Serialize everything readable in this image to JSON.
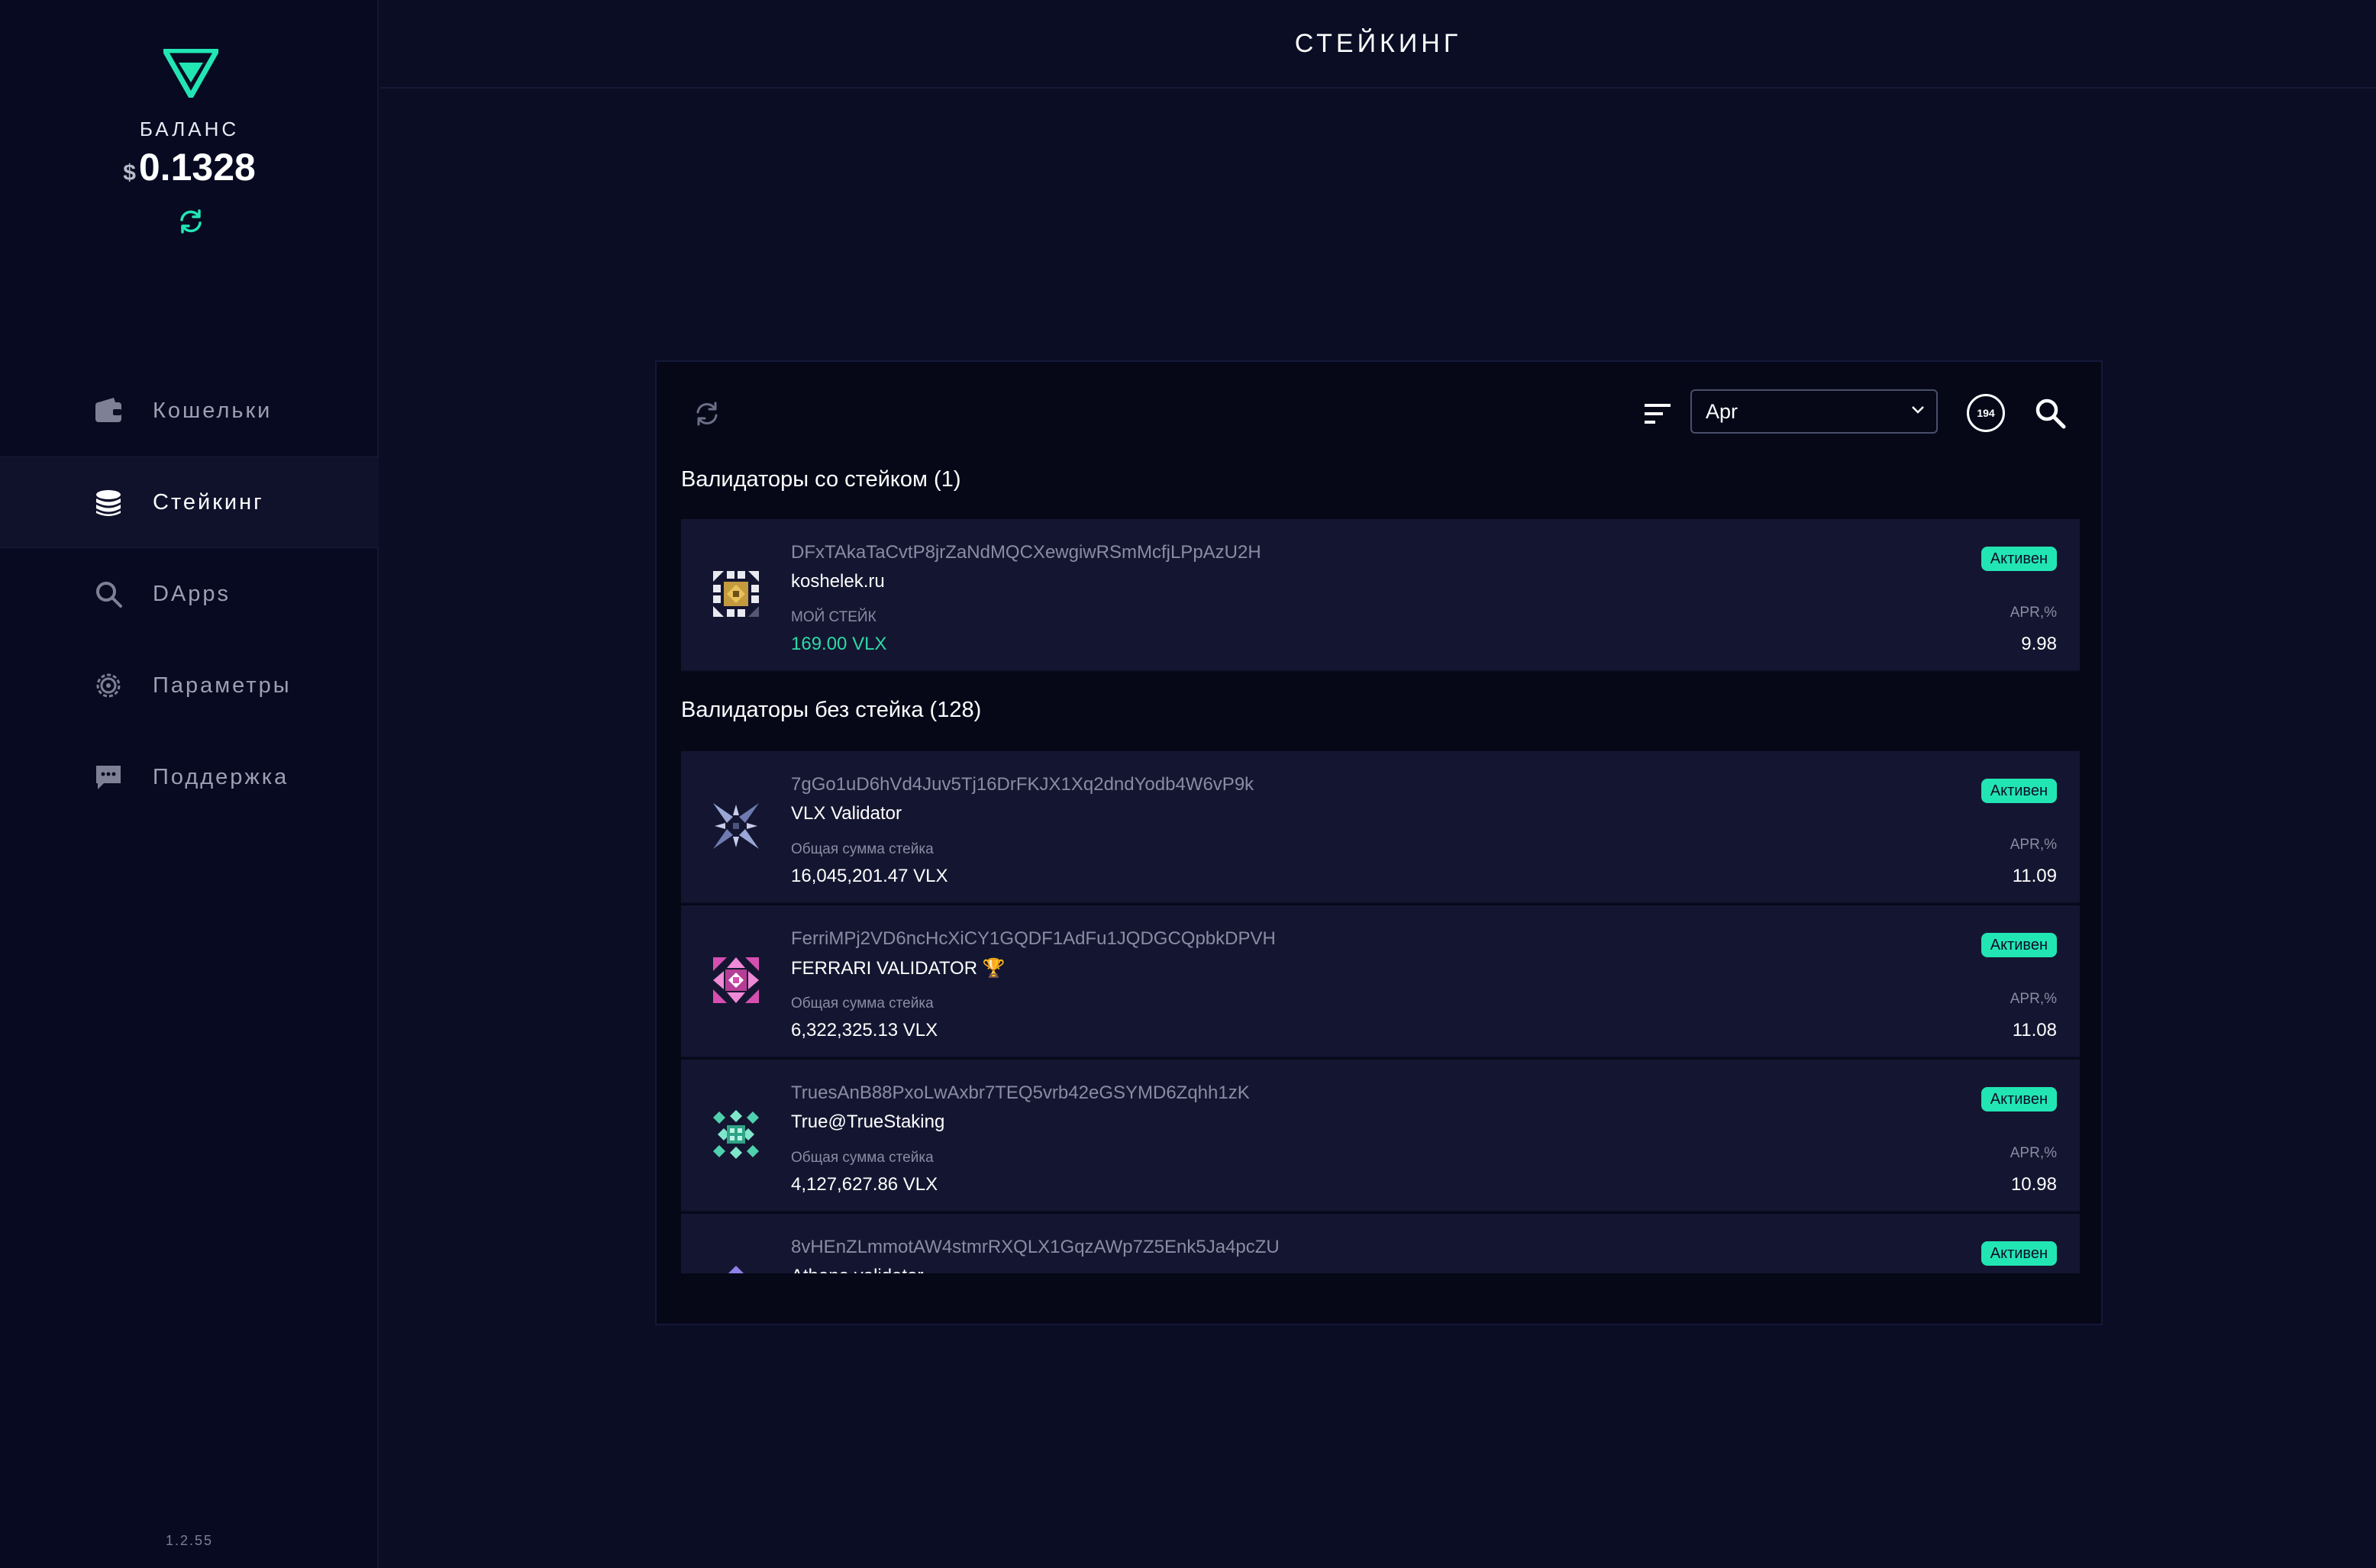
{
  "sidebar": {
    "balance_label": "БАЛАНС",
    "balance_currency": "$",
    "balance_value": "0.1328",
    "version": "1.2.55",
    "items": [
      {
        "label": "Кошельки",
        "icon": "wallet-icon"
      },
      {
        "label": "Стейкинг",
        "icon": "coins-stack-icon",
        "active": true
      },
      {
        "label": "DApps",
        "icon": "search-icon"
      },
      {
        "label": "Параметры",
        "icon": "gear-icon"
      },
      {
        "label": "Поддержка",
        "icon": "chat-icon"
      }
    ]
  },
  "header": {
    "title": "СТЕЙКИНГ"
  },
  "toolbar": {
    "sort_selected": "Apr",
    "count": "194"
  },
  "staked": {
    "title": "Валидаторы со стейком (1)",
    "items": [
      {
        "address": "DFxTAkaTaCvtP8jrZaNdMQCXewgiwRSmMcfjLPpAzU2H",
        "name": "koshelek.ru",
        "stake_label": "МОЙ СТЕЙК",
        "stake_value": "169.00 VLX",
        "status": "Активен",
        "apr_label": "APR,%",
        "apr_value": "9.98"
      }
    ]
  },
  "unstaked": {
    "title": "Валидаторы без стейка (128)",
    "items": [
      {
        "address": "7gGo1uD6hVd4Juv5Tj16DrFKJX1Xq2dndYodb4W6vP9k",
        "name": "VLX Validator",
        "stake_label": "Общая сумма стейка",
        "stake_value": "16,045,201.47 VLX",
        "status": "Активен",
        "apr_label": "APR,%",
        "apr_value": "11.09"
      },
      {
        "address": "FerriMPj2VD6ncHcXiCY1GQDF1AdFu1JQDGCQpbkDPVH",
        "name": "FERRARI VALIDATOR 🏆",
        "stake_label": "Общая сумма стейка",
        "stake_value": "6,322,325.13 VLX",
        "status": "Активен",
        "apr_label": "APR,%",
        "apr_value": "11.08"
      },
      {
        "address": "TruesAnB88PxoLwAxbr7TEQ5vrb42eGSYMD6Zqhh1zK",
        "name": "True@TrueStaking",
        "stake_label": "Общая сумма стейка",
        "stake_value": "4,127,627.86 VLX",
        "status": "Активен",
        "apr_label": "APR,%",
        "apr_value": "10.98"
      },
      {
        "address": "8vHEnZLmmotAW4stmrRXQLX1GqzAWp7Z5Enk5Ja4pcZU",
        "name": "Athena validator",
        "stake_label": "",
        "stake_value": "",
        "status": "Активен",
        "apr_label": "",
        "apr_value": ""
      }
    ]
  },
  "colors": {
    "accent": "#22e5b4",
    "background": "#0b0d25",
    "sidebar": "#080a22",
    "card": "#141631"
  }
}
